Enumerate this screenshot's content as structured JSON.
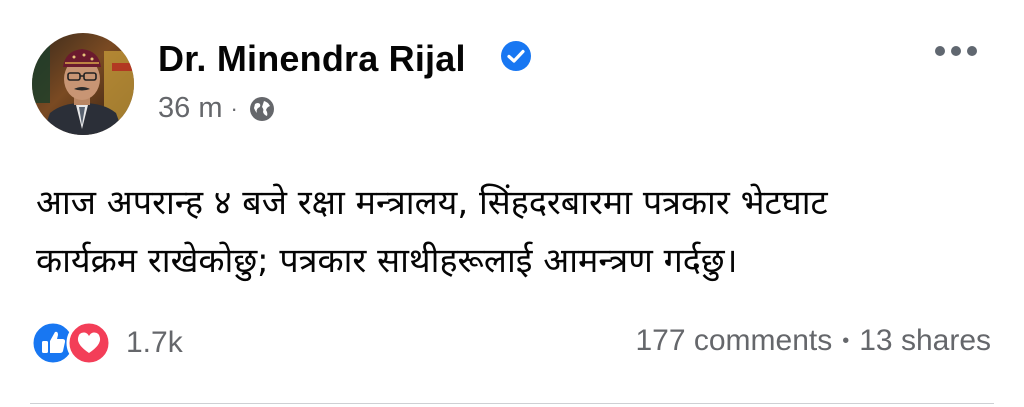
{
  "post": {
    "author": "Dr. Minendra Rijal",
    "timestamp": "36 m",
    "meta_separator": "·",
    "verified": true,
    "audience_icon": "globe-icon",
    "body_text": "आज अपरान्ह ४ बजे रक्षा मन्त्रालय, सिंहदरबारमा पत्रकार भेटघाट\nकार्यक्रम राखेकोछु; पत्रकार साथीहरूलाई आमन्त्रण गर्दछु।",
    "reactions": {
      "icons": [
        "like-icon",
        "love-icon"
      ],
      "count": "1.7k"
    },
    "stats": {
      "comments": "177 comments",
      "separator": "•",
      "shares": "13 shares"
    }
  },
  "colors": {
    "facebook_blue": "#1877f2",
    "love_red": "#f33e58",
    "secondary_text": "#65676b",
    "primary_text": "#050505"
  }
}
